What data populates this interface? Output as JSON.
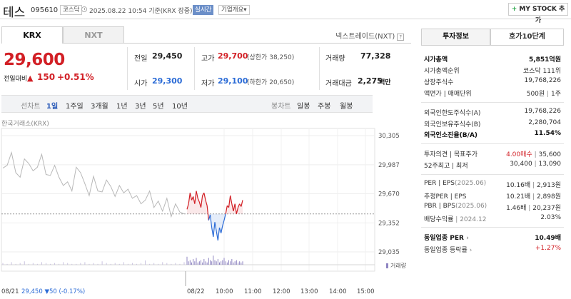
{
  "header": {
    "stock_name": "테스",
    "stock_code": "095610",
    "market_badge": "코스닥",
    "datetime": "2025.08.22 10:54",
    "basis": "기준(KRX 장중)",
    "realtime_badge": "실시간",
    "company_overview_badge": "기업개요",
    "mystock_button": "MY STOCK 추가"
  },
  "tabs": {
    "krx": "KRX",
    "nxt": "NXT",
    "nextrade_link": "넥스트레이드(NXT)"
  },
  "price": {
    "current": "29,600",
    "change_label": "전일대비",
    "change_arrow": "▲",
    "change_value": "150",
    "change_percent": "+0.51%"
  },
  "quote": {
    "prev_close_label": "전일",
    "prev_close": "29,450",
    "open_label": "시가",
    "open": "29,300",
    "high_label": "고가",
    "high": "29,700",
    "upper_limit": "(상한가 38,250)",
    "low_label": "저가",
    "low": "29,100",
    "lower_limit": "(하한가 20,650)",
    "volume_label": "거래량",
    "volume": "77,328",
    "amount_label": "거래대금",
    "amount": "2,275",
    "amount_unit": "백만"
  },
  "period_bar": {
    "line_chart": "선차트",
    "periods": [
      "1일",
      "1주일",
      "3개월",
      "1년",
      "3년",
      "5년",
      "10년"
    ],
    "selected": "1일",
    "candle_chart": "봉차트",
    "candle_periods": [
      "일봉",
      "주봉",
      "월봉"
    ]
  },
  "chart_label": "한국거래소(KRX)",
  "chart_data": {
    "type": "line",
    "y_ticks": [
      "30,305",
      "29,987",
      "29,670",
      "29,352",
      "29,035"
    ],
    "y_tick_values": [
      30305,
      29987,
      29670,
      29352,
      29035
    ],
    "x_ticks": [
      "08/21",
      "08/22",
      "10:00",
      "11:00",
      "12:00",
      "13:00",
      "14:00",
      "15:00"
    ],
    "baseline": 29450,
    "volume_label": "거래량",
    "prev_day_series": [
      29950,
      29980,
      30120,
      29900,
      29850,
      30050,
      30000,
      29920,
      29960,
      30100,
      29880,
      29870,
      29980,
      29850,
      29760,
      29800,
      29700,
      29960,
      29900,
      29780,
      29650,
      29860,
      29700,
      29690,
      29820,
      29750,
      29640,
      29760,
      29680,
      29720,
      29620,
      29650,
      29560,
      29600,
      29700,
      29520,
      29590,
      29480,
      29620,
      29420,
      29560,
      29470,
      29450
    ],
    "today_series": [
      29500,
      29560,
      29680,
      29600,
      29640,
      29560,
      29700,
      29620,
      29580,
      29520,
      29650,
      29680,
      29600,
      29540,
      29380,
      29440,
      29300,
      29200,
      29360,
      29260,
      29160,
      29300,
      29240,
      29320,
      29380,
      29450,
      29540,
      29520,
      29650,
      29560,
      29480,
      29560,
      29450,
      29520,
      29560,
      29530,
      29600
    ],
    "volume_prev": [
      2,
      1,
      3,
      1,
      2,
      4,
      1,
      2,
      1,
      3,
      2,
      1,
      2,
      1,
      3,
      2,
      1,
      1,
      2,
      3,
      1,
      2,
      1,
      4,
      2,
      1,
      2,
      1,
      3,
      1,
      2,
      1,
      2,
      5,
      1,
      2,
      1,
      3,
      2,
      1,
      2,
      1,
      3
    ],
    "volume_today": [
      7,
      3,
      4,
      2,
      5,
      3,
      6,
      2,
      3,
      4,
      2,
      5,
      3,
      2,
      6,
      4,
      3,
      8,
      4,
      3,
      5,
      2,
      3,
      4,
      6,
      3,
      2,
      4,
      3,
      5,
      2,
      3,
      4,
      2,
      3,
      2,
      3
    ],
    "footer_date": "08/21",
    "footer_price": "29,450",
    "footer_arrow": "▼",
    "footer_change": "50",
    "footer_percent": "(-0.17%)"
  },
  "right_panel": {
    "tab_invest": "투자정보",
    "tab_quote10": "호가10단계",
    "market_cap_label": "시가총액",
    "market_cap": "5,851억원",
    "rank_label": "시가총액순위",
    "rank": "코스닥 111위",
    "shares_label": "상장주식수",
    "shares": "19,768,226",
    "par_label": "액면가 | 매매단위",
    "par": "500원",
    "unit": "1주",
    "foreign_limit_label": "외국인한도주식수(A)",
    "foreign_limit": "19,768,226",
    "foreign_hold_label": "외국인보유주식수(B)",
    "foreign_hold": "2,280,704",
    "foreign_ratio_label": "외국인소진율(B/A)",
    "foreign_ratio": "11.54%",
    "opinion_label": "투자의견 | 목표주가",
    "opinion": "4.00매수",
    "target": "35,600",
    "w52_label": "52주최고 | 최저",
    "w52_high": "30,400",
    "w52_low": "13,090",
    "per_label": "PER | EPS",
    "per_period": "(2025.06)",
    "per": "10.16배",
    "eps": "2,913원",
    "eper_label": "추정PER | EPS",
    "eper": "10.21배",
    "eeps": "2,898원",
    "pbr_label": "PBR | BPS",
    "pbr_period": "(2025.06)",
    "pbr": "1.46배",
    "bps": "20,237원",
    "div_label": "배당수익률",
    "div_period": "2024.12",
    "div": "2.03%",
    "sector_per_label": "동일업종 PER",
    "sector_per": "10.49배",
    "sector_chg_label": "동일업종 등락률",
    "sector_chg": "+1.27%"
  },
  "colors": {
    "up": "#d21f25",
    "down": "#2b6bd6",
    "prev_line": "#b8b8b8"
  }
}
